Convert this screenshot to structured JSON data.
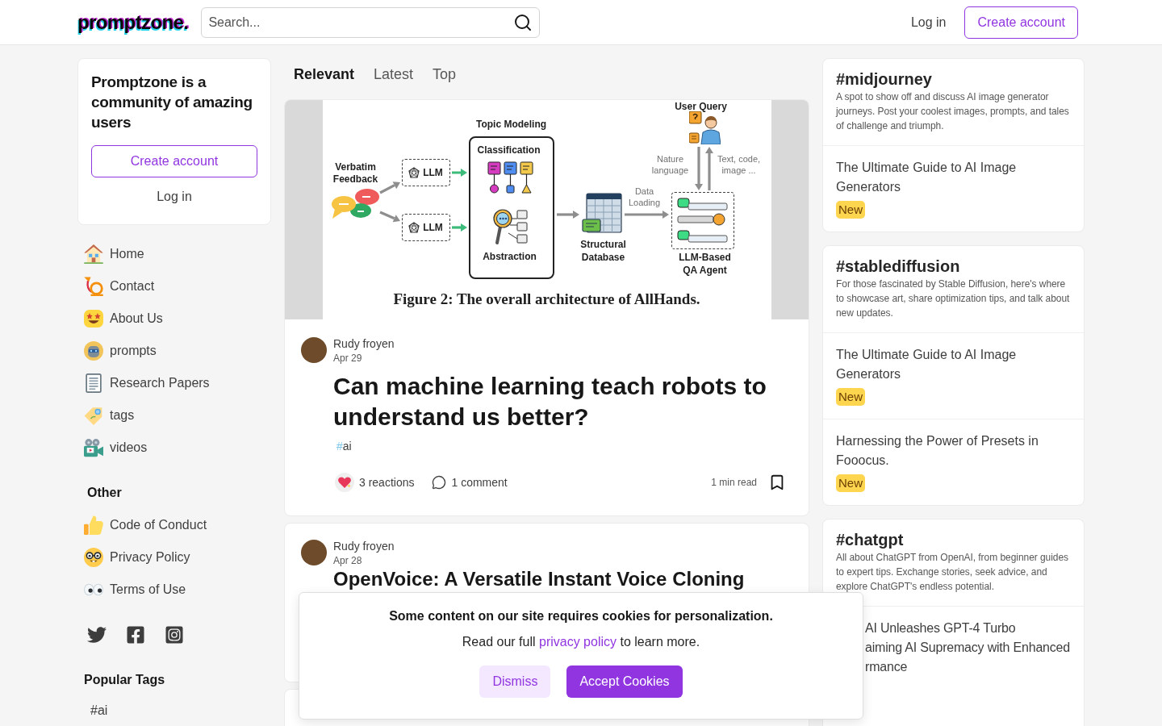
{
  "header": {
    "logo": "promptzone.",
    "search": {
      "placeholder": "Search..."
    },
    "login": "Log in",
    "create_account": "Create account"
  },
  "sidebar": {
    "promo": {
      "heading": "Promptzone is a community of amazing users",
      "create_account": "Create account",
      "login": "Log in"
    },
    "nav": [
      {
        "label": "Home"
      },
      {
        "label": "Contact"
      },
      {
        "label": "About Us"
      },
      {
        "label": "prompts"
      },
      {
        "label": "Research Papers"
      },
      {
        "label": "tags"
      },
      {
        "label": "videos"
      }
    ],
    "other": {
      "heading": "Other",
      "items": [
        {
          "label": "Code of Conduct"
        },
        {
          "label": "Privacy Policy"
        },
        {
          "label": "Terms of Use"
        }
      ]
    },
    "popular_tags": {
      "heading": "Popular Tags",
      "tags": [
        "#ai"
      ]
    }
  },
  "feed": {
    "tabs": [
      {
        "label": "Relevant",
        "selected": true
      },
      {
        "label": "Latest",
        "selected": false
      },
      {
        "label": "Top",
        "selected": false
      }
    ],
    "posts": [
      {
        "kind": "featured",
        "cover": {
          "query": "User Query",
          "query_in": "Nature language",
          "query_out": "Text, code, image ...",
          "source": "Verbatim Feedback",
          "models": [
            "LLM",
            "LLM"
          ],
          "topic": {
            "title": "Topic Modeling",
            "steps": [
              "Classification",
              "Abstraction"
            ]
          },
          "database": "Structural Database",
          "loading": "Data Loading",
          "agent": "LLM-Based QA Agent",
          "caption": "Figure 2: The overall architecture of AllHands."
        },
        "author": "Rudy froyen",
        "date": "Apr 29",
        "title": "Can machine learning teach robots to understand us better?",
        "tags": [
          {
            "prefix": "#",
            "name": "ai",
            "color": "#7cc7e8"
          }
        ],
        "reactions": "3 reactions",
        "comments": "1 comment",
        "read_time": "1 min read"
      },
      {
        "kind": "standard",
        "author": "Rudy froyen",
        "date": "Apr 28",
        "title": "OpenVoice: A Versatile Instant Voice Cloning"
      }
    ],
    "more_posts": true
  },
  "tag_cards": [
    {
      "tag": "#midjourney",
      "description": "A spot to show off and discuss AI image generator journeys. Post your coolest images, prompts, and tales of challenge and triumph.",
      "articles": [
        {
          "title": "The Ultimate Guide to AI Image Generators",
          "badge": "New"
        }
      ]
    },
    {
      "tag": "#stablediffusion",
      "description": "For those fascinated by Stable Diffusion, here's where to showcase art, share optimization tips, and talk about new updates.",
      "articles": [
        {
          "title": "The Ultimate Guide to AI Image Generators",
          "badge": "New"
        },
        {
          "title": "Harnessing the Power of Presets in Fooocus.",
          "badge": "New"
        }
      ]
    },
    {
      "tag": "#chatgpt",
      "description": "All about ChatGPT from OpenAI, from beginner guides to expert tips. Exchange stories, seek advice, and explore ChatGPT's endless potential.",
      "articles": [
        {
          "title_lines": [
            "AI Unleashes GPT-4 Turbo",
            "aiming AI Supremacy with Enhanced",
            "rmance"
          ]
        }
      ]
    }
  ],
  "cookie_banner": {
    "message": "Some content on our site requires cookies for personalization.",
    "note_before": "Read our full",
    "link": "privacy policy",
    "note_after": "to learn more.",
    "buttons": [
      {
        "kind": "secondary",
        "label": "Dismiss"
      },
      {
        "kind": "primary",
        "label": "Accept Cookies"
      }
    ]
  }
}
